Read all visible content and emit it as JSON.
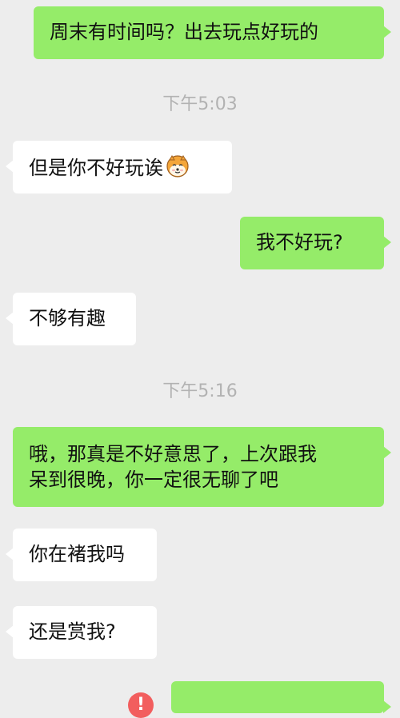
{
  "messages": [
    {
      "text": "周末有时间吗？出去玩点好玩的"
    },
    {
      "time": "下午5:03"
    },
    {
      "text": "但是你不好玩诶",
      "emoji": "shiba-emoji-icon"
    },
    {
      "text": "我不好玩?"
    },
    {
      "text": "不够有趣"
    },
    {
      "time": "下午5:16"
    },
    {
      "lines": [
        "哦，那真是不好意思了，上次跟我",
        "呆到很晚，你一定很无聊了吧"
      ]
    },
    {
      "text": "你在褚我吗"
    },
    {
      "text": "还是赏我?"
    }
  ],
  "colors": {
    "outgoing": "#95ec69",
    "incoming": "#ffffff",
    "background": "#ededed",
    "timestamp": "#b2b2b2",
    "error": "#f25e5e"
  }
}
